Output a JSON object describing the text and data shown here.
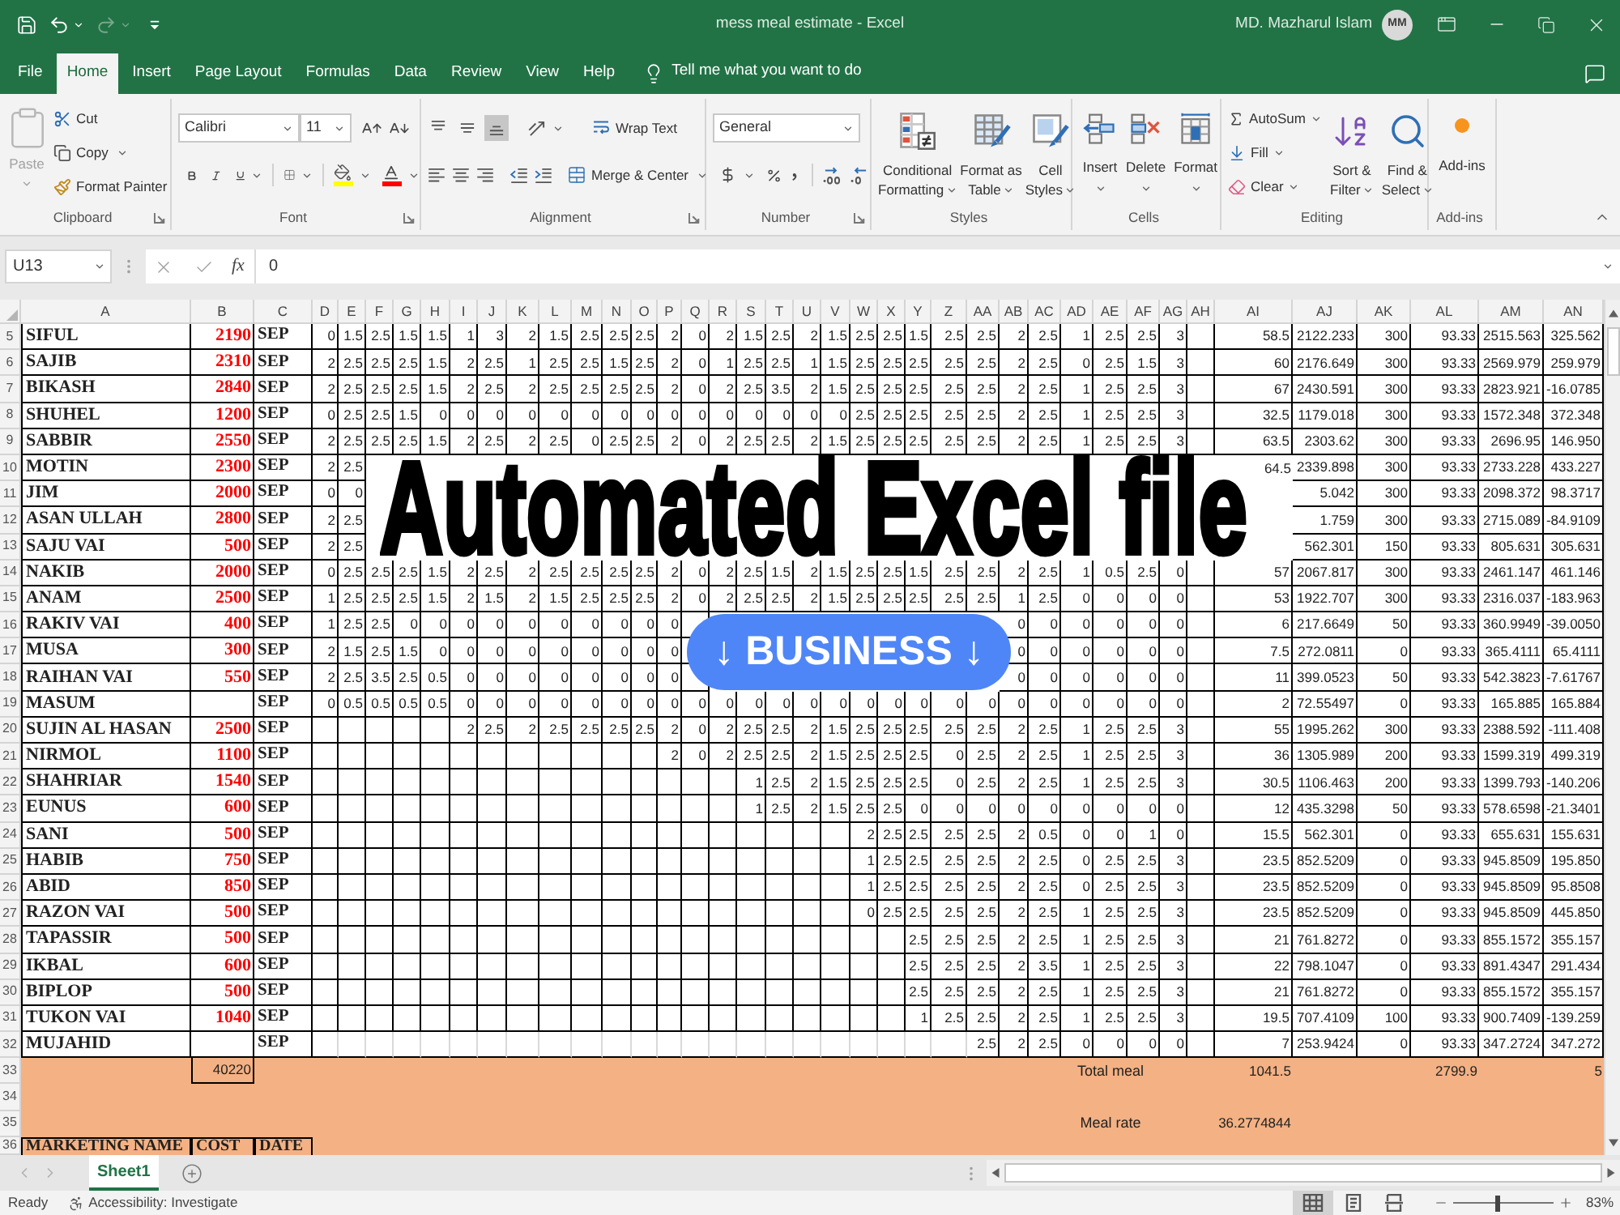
{
  "title_bar": {
    "title": "mess meal estimate - Excel",
    "user": "MD. Mazharul Islam",
    "avatar": "MM",
    "quick_access": [
      {
        "kind": "save",
        "disabled": false
      },
      {
        "kind": "undo",
        "disabled": false
      },
      {
        "kind": "redo",
        "disabled": true
      },
      {
        "kind": "customize",
        "disabled": false
      }
    ]
  },
  "menu_tabs": [
    {
      "label": "File",
      "selected": false
    },
    {
      "label": "Home",
      "selected": true
    },
    {
      "label": "Insert",
      "selected": false
    },
    {
      "label": "Page Layout",
      "selected": false
    },
    {
      "label": "Formulas",
      "selected": false
    },
    {
      "label": "Data",
      "selected": false
    },
    {
      "label": "Review",
      "selected": false
    },
    {
      "label": "View",
      "selected": false
    },
    {
      "label": "Help",
      "selected": false
    }
  ],
  "tell_me": "Tell me what you want to do",
  "ribbon": {
    "clipboard": {
      "label": "Clipboard",
      "paste": {
        "label": "Paste",
        "disabled": true
      },
      "cut": "Cut",
      "copy": "Copy",
      "format_painter": "Format Painter"
    },
    "font": {
      "label": "Font",
      "name": "Calibri",
      "size": "11"
    },
    "alignment": {
      "label": "Alignment",
      "vertical": [
        {
          "kind": "top",
          "selected": false
        },
        {
          "kind": "middle",
          "selected": false
        },
        {
          "kind": "bottom",
          "selected": true
        }
      ],
      "wrap_text": "Wrap Text",
      "merge": "Merge & Center"
    },
    "number": {
      "label": "Number",
      "format": "General"
    },
    "styles": {
      "label": "Styles",
      "buttons": [
        {
          "kind": "conditional",
          "lines": [
            "Conditional",
            "Formatting"
          ]
        },
        {
          "kind": "table",
          "lines": [
            "Format as",
            "Table"
          ]
        },
        {
          "kind": "cell",
          "lines": [
            "Cell",
            "Styles"
          ]
        }
      ]
    },
    "cells": {
      "label": "Cells",
      "buttons": [
        {
          "kind": "insert",
          "label": "Insert"
        },
        {
          "kind": "delete",
          "label": "Delete"
        },
        {
          "kind": "format",
          "label": "Format"
        }
      ]
    },
    "editing": {
      "label": "Editing",
      "autosum": "AutoSum",
      "fill": "Fill",
      "clear": "Clear",
      "sort": [
        "Sort &",
        "Filter"
      ],
      "find": [
        "Find &",
        "Select"
      ]
    },
    "addins": {
      "label": "Add-ins",
      "button": "Add-ins"
    }
  },
  "formula_bar": {
    "name_box": "U13",
    "function_icon": "fx",
    "formula": "0"
  },
  "sheet": {
    "columns": [
      "A",
      "B",
      "C",
      "D",
      "E",
      "F",
      "G",
      "H",
      "I",
      "J",
      "K",
      "L",
      "M",
      "N",
      "O",
      "P",
      "Q",
      "R",
      "S",
      "T",
      "U",
      "V",
      "W",
      "X",
      "Y",
      "Z",
      "AA",
      "AB",
      "AC",
      "AD",
      "AE",
      "AF",
      "AG",
      "AH",
      "AI",
      "AJ",
      "AK",
      "AL",
      "AM",
      "AN"
    ],
    "rows": [
      {
        "number": "5",
        "kind": "member",
        "cells": [
          "SIFUL",
          "2190",
          "SEP",
          "0",
          "1.5",
          "2.5",
          "1.5",
          "1.5",
          "1",
          "3",
          "2",
          "1.5",
          "2.5",
          "2.5",
          "2.5",
          "2",
          "0",
          "2",
          "1.5",
          "2.5",
          "2",
          "1.5",
          "2.5",
          "2.5",
          "1.5",
          "2.5",
          "2.5",
          "2",
          "2.5",
          "1",
          "2.5",
          "2.5",
          "3",
          null,
          "58.5",
          "2122.233",
          "300",
          "93.33",
          "2515.563",
          "325.562"
        ]
      },
      {
        "number": "6",
        "kind": "member",
        "cells": [
          "SAJIB",
          "2310",
          "SEP",
          "2",
          "2.5",
          "2.5",
          "2.5",
          "1.5",
          "2",
          "2.5",
          "1",
          "2.5",
          "2.5",
          "1.5",
          "2.5",
          "2",
          "0",
          "1",
          "2.5",
          "2.5",
          "1",
          "1.5",
          "2.5",
          "2.5",
          "2.5",
          "2.5",
          "2.5",
          "2",
          "2.5",
          "0",
          "2.5",
          "1.5",
          "3",
          null,
          "60",
          "2176.649",
          "300",
          "93.33",
          "2569.979",
          "259.979"
        ]
      },
      {
        "number": "7",
        "kind": "member",
        "cells": [
          "BIKASH",
          "2840",
          "SEP",
          "2",
          "2.5",
          "2.5",
          "2.5",
          "1.5",
          "2",
          "2.5",
          "2",
          "2.5",
          "2.5",
          "2.5",
          "2.5",
          "2",
          "0",
          "2",
          "2.5",
          "3.5",
          "2",
          "1.5",
          "2.5",
          "2.5",
          "2.5",
          "2.5",
          "2.5",
          "2",
          "2.5",
          "1",
          "2.5",
          "2.5",
          "3",
          null,
          "67",
          "2430.591",
          "300",
          "93.33",
          "2823.921",
          "-16.0785"
        ]
      },
      {
        "number": "8",
        "kind": "member",
        "cells": [
          "SHUHEL",
          "1200",
          "SEP",
          "0",
          "2.5",
          "2.5",
          "1.5",
          "0",
          "0",
          "0",
          "0",
          "0",
          "0",
          "0",
          "0",
          "0",
          "0",
          "0",
          "0",
          "0",
          "0",
          "0",
          "2.5",
          "2.5",
          "2.5",
          "2.5",
          "2.5",
          "2",
          "2.5",
          "1",
          "2.5",
          "2.5",
          "3",
          null,
          "32.5",
          "1179.018",
          "300",
          "93.33",
          "1572.348",
          "372.348"
        ]
      },
      {
        "number": "9",
        "kind": "member",
        "cells": [
          "SABBIR",
          "2550",
          "SEP",
          "2",
          "2.5",
          "2.5",
          "2.5",
          "1.5",
          "2",
          "2.5",
          "2",
          "2.5",
          "0",
          "2.5",
          "2.5",
          "2",
          "0",
          "2",
          "2.5",
          "2.5",
          "2",
          "1.5",
          "2.5",
          "2.5",
          "2.5",
          "2.5",
          "2.5",
          "2",
          "2.5",
          "1",
          "2.5",
          "2.5",
          "3",
          null,
          "63.5",
          "2303.62",
          "300",
          "93.33",
          "2696.95",
          "146.950"
        ]
      },
      {
        "number": "10",
        "kind": "member",
        "cells": [
          "MOTIN",
          "2300",
          "SEP",
          "2",
          "2.5",
          null,
          null,
          null,
          null,
          null,
          null,
          null,
          null,
          null,
          null,
          null,
          null,
          null,
          null,
          null,
          null,
          null,
          null,
          null,
          null,
          null,
          null,
          null,
          null,
          null,
          null,
          null,
          null,
          null,
          "64.5",
          "2339.898",
          "300",
          "93.33",
          "2733.228",
          "433.227"
        ]
      },
      {
        "number": "11",
        "kind": "member",
        "cells": [
          "JIM",
          "2000",
          "SEP",
          "0",
          "0",
          null,
          null,
          null,
          null,
          null,
          null,
          null,
          null,
          null,
          null,
          null,
          null,
          null,
          null,
          null,
          null,
          null,
          null,
          null,
          null,
          null,
          null,
          null,
          null,
          null,
          null,
          null,
          null,
          null,
          null,
          "5.042",
          "300",
          "93.33",
          "2098.372",
          "98.3717"
        ]
      },
      {
        "number": "12",
        "kind": "member",
        "cells": [
          "ASAN ULLAH",
          "2800",
          "SEP",
          "2",
          "2.5",
          null,
          null,
          null,
          null,
          null,
          null,
          null,
          null,
          null,
          null,
          null,
          null,
          null,
          null,
          null,
          null,
          null,
          null,
          null,
          null,
          null,
          null,
          null,
          null,
          null,
          null,
          null,
          null,
          null,
          null,
          "1.759",
          "300",
          "93.33",
          "2715.089",
          "-84.9109"
        ]
      },
      {
        "number": "13",
        "kind": "member",
        "cells": [
          "SAJU VAI",
          "500",
          "SEP",
          "2",
          "2.5",
          null,
          null,
          null,
          null,
          null,
          null,
          null,
          null,
          null,
          null,
          null,
          null,
          null,
          null,
          null,
          null,
          null,
          null,
          null,
          null,
          null,
          null,
          null,
          null,
          null,
          null,
          null,
          null,
          null,
          null,
          "562.301",
          "150",
          "93.33",
          "805.631",
          "305.631"
        ]
      },
      {
        "number": "14",
        "kind": "member",
        "cells": [
          "NAKIB",
          "2000",
          "SEP",
          "0",
          "2.5",
          "2.5",
          "2.5",
          "1.5",
          "2",
          "2.5",
          "2",
          "2.5",
          "2.5",
          "2.5",
          "2.5",
          "2",
          "0",
          "2",
          "2.5",
          "1.5",
          "2",
          "1.5",
          "2.5",
          "2.5",
          "1.5",
          "2.5",
          "2.5",
          "2",
          "2.5",
          "1",
          "0.5",
          "2.5",
          "0",
          null,
          "57",
          "2067.817",
          "300",
          "93.33",
          "2461.147",
          "461.146"
        ]
      },
      {
        "number": "15",
        "kind": "member",
        "cells": [
          "ANAM",
          "2500",
          "SEP",
          "1",
          "2.5",
          "2.5",
          "2.5",
          "1.5",
          "2",
          "1.5",
          "2",
          "1.5",
          "2.5",
          "2.5",
          "2.5",
          "2",
          "0",
          "2",
          "2.5",
          "2.5",
          "2",
          "1.5",
          "2.5",
          "2.5",
          "2.5",
          "2.5",
          "2.5",
          "1",
          "2.5",
          "0",
          "0",
          "0",
          "0",
          null,
          "53",
          "1922.707",
          "300",
          "93.33",
          "2316.037",
          "-183.963"
        ]
      },
      {
        "number": "16",
        "kind": "member",
        "cells": [
          "RAKIV VAI",
          "400",
          "SEP",
          "1",
          "2.5",
          "2.5",
          "0",
          "0",
          "0",
          "0",
          "0",
          "0",
          "0",
          "0",
          "0",
          "0",
          null,
          null,
          null,
          null,
          null,
          null,
          null,
          null,
          null,
          null,
          null,
          "0",
          "0",
          "0",
          "0",
          "0",
          "0",
          null,
          "6",
          "217.6649",
          "50",
          "93.33",
          "360.9949",
          "-39.0050"
        ]
      },
      {
        "number": "17",
        "kind": "member",
        "cells": [
          "MUSA",
          "300",
          "SEP",
          "2",
          "1.5",
          "2.5",
          "1.5",
          "0",
          "0",
          "0",
          "0",
          "0",
          "0",
          "0",
          "0",
          "0",
          null,
          null,
          null,
          null,
          null,
          null,
          null,
          null,
          null,
          null,
          null,
          "0",
          "0",
          "0",
          "0",
          "0",
          "0",
          null,
          "7.5",
          "272.0811",
          "0",
          "93.33",
          "365.4111",
          "65.4111"
        ]
      },
      {
        "number": "18",
        "kind": "member",
        "cells": [
          "RAIHAN VAI",
          "550",
          "SEP",
          "2",
          "2.5",
          "3.5",
          "2.5",
          "0.5",
          "0",
          "0",
          "0",
          "0",
          "0",
          "0",
          "0",
          "0",
          null,
          null,
          null,
          null,
          null,
          null,
          null,
          null,
          null,
          null,
          null,
          "0",
          "0",
          "0",
          "0",
          "0",
          "0",
          null,
          "11",
          "399.0523",
          "50",
          "93.33",
          "542.3823",
          "-7.61767"
        ]
      },
      {
        "number": "19",
        "kind": "member",
        "cells": [
          "MASUM",
          null,
          "SEP",
          "0",
          "0.5",
          "0.5",
          "0.5",
          "0.5",
          "0",
          "0",
          "0",
          "0",
          "0",
          "0",
          "0",
          "0",
          "0",
          "0",
          "0",
          "0",
          "0",
          "0",
          "0",
          "0",
          "0",
          "0",
          "0",
          "0",
          "0",
          "0",
          "0",
          "0",
          "0",
          null,
          "2",
          "72.55497",
          "0",
          "93.33",
          "165.885",
          "165.884"
        ]
      },
      {
        "number": "20",
        "kind": "member",
        "cells": [
          "SUJIN AL HASAN",
          "2500",
          "SEP",
          null,
          null,
          null,
          null,
          null,
          "2",
          "2.5",
          "2",
          "2.5",
          "2.5",
          "2.5",
          "2.5",
          "2",
          "0",
          "2",
          "2.5",
          "2.5",
          "2",
          "1.5",
          "2.5",
          "2.5",
          "2.5",
          "2.5",
          "2.5",
          "2",
          "2.5",
          "1",
          "2.5",
          "2.5",
          "3",
          null,
          "55",
          "1995.262",
          "300",
          "93.33",
          "2388.592",
          "-111.408"
        ]
      },
      {
        "number": "21",
        "kind": "member",
        "cells": [
          "NIRMOL",
          "1100",
          "SEP",
          null,
          null,
          null,
          null,
          null,
          null,
          null,
          null,
          null,
          null,
          null,
          null,
          "2",
          "0",
          "2",
          "2.5",
          "2.5",
          "2",
          "1.5",
          "2.5",
          "2.5",
          "2.5",
          "0",
          "2.5",
          "2",
          "2.5",
          "1",
          "2.5",
          "2.5",
          "3",
          null,
          "36",
          "1305.989",
          "200",
          "93.33",
          "1599.319",
          "499.319"
        ]
      },
      {
        "number": "22",
        "kind": "member",
        "cells": [
          "SHAHRIAR",
          "1540",
          "SEP",
          null,
          null,
          null,
          null,
          null,
          null,
          null,
          null,
          null,
          null,
          null,
          null,
          null,
          null,
          null,
          "1",
          "2.5",
          "2",
          "1.5",
          "2.5",
          "2.5",
          "2.5",
          "0",
          "2.5",
          "2",
          "2.5",
          "1",
          "2.5",
          "2.5",
          "3",
          null,
          "30.5",
          "1106.463",
          "200",
          "93.33",
          "1399.793",
          "-140.206"
        ]
      },
      {
        "number": "23",
        "kind": "member",
        "cells": [
          "EUNUS",
          "600",
          "SEP",
          null,
          null,
          null,
          null,
          null,
          null,
          null,
          null,
          null,
          null,
          null,
          null,
          null,
          null,
          null,
          "1",
          "2.5",
          "2",
          "1.5",
          "2.5",
          "2.5",
          "0",
          "0",
          "0",
          "0",
          "0",
          "0",
          "0",
          "0",
          "0",
          null,
          "12",
          "435.3298",
          "50",
          "93.33",
          "578.6598",
          "-21.3401"
        ]
      },
      {
        "number": "24",
        "kind": "member",
        "cells": [
          "SANI",
          "500",
          "SEP",
          null,
          null,
          null,
          null,
          null,
          null,
          null,
          null,
          null,
          null,
          null,
          null,
          null,
          null,
          null,
          null,
          null,
          null,
          null,
          "2",
          "2.5",
          "2.5",
          "2.5",
          "2.5",
          "2",
          "0.5",
          "0",
          "0",
          "1",
          "0",
          null,
          "15.5",
          "562.301",
          "0",
          "93.33",
          "655.631",
          "155.631"
        ]
      },
      {
        "number": "25",
        "kind": "member",
        "cells": [
          "HABIB",
          "750",
          "SEP",
          null,
          null,
          null,
          null,
          null,
          null,
          null,
          null,
          null,
          null,
          null,
          null,
          null,
          null,
          null,
          null,
          null,
          null,
          null,
          "1",
          "2.5",
          "2.5",
          "2.5",
          "2.5",
          "2",
          "2.5",
          "0",
          "2.5",
          "2.5",
          "3",
          null,
          "23.5",
          "852.5209",
          "0",
          "93.33",
          "945.8509",
          "195.850"
        ]
      },
      {
        "number": "26",
        "kind": "member",
        "cells": [
          "ABID",
          "850",
          "SEP",
          null,
          null,
          null,
          null,
          null,
          null,
          null,
          null,
          null,
          null,
          null,
          null,
          null,
          null,
          null,
          null,
          null,
          null,
          null,
          "1",
          "2.5",
          "2.5",
          "2.5",
          "2.5",
          "2",
          "2.5",
          "0",
          "2.5",
          "2.5",
          "3",
          null,
          "23.5",
          "852.5209",
          "0",
          "93.33",
          "945.8509",
          "95.8508"
        ]
      },
      {
        "number": "27",
        "kind": "member",
        "cells": [
          "RAZON VAI",
          "500",
          "SEP",
          null,
          null,
          null,
          null,
          null,
          null,
          null,
          null,
          null,
          null,
          null,
          null,
          null,
          null,
          null,
          null,
          null,
          null,
          null,
          "0",
          "2.5",
          "2.5",
          "2.5",
          "2.5",
          "2",
          "2.5",
          "1",
          "2.5",
          "2.5",
          "3",
          null,
          "23.5",
          "852.5209",
          "0",
          "93.33",
          "945.8509",
          "445.850"
        ]
      },
      {
        "number": "28",
        "kind": "member",
        "cells": [
          "TAPASSIR",
          "500",
          "SEP",
          null,
          null,
          null,
          null,
          null,
          null,
          null,
          null,
          null,
          null,
          null,
          null,
          null,
          null,
          null,
          null,
          null,
          null,
          null,
          null,
          null,
          "2.5",
          "2.5",
          "2.5",
          "2",
          "2.5",
          "1",
          "2.5",
          "2.5",
          "3",
          null,
          "21",
          "761.8272",
          "0",
          "93.33",
          "855.1572",
          "355.157"
        ]
      },
      {
        "number": "29",
        "kind": "member",
        "cells": [
          "IKBAL",
          "600",
          "SEP",
          null,
          null,
          null,
          null,
          null,
          null,
          null,
          null,
          null,
          null,
          null,
          null,
          null,
          null,
          null,
          null,
          null,
          null,
          null,
          null,
          null,
          "2.5",
          "2.5",
          "2.5",
          "2",
          "3.5",
          "1",
          "2.5",
          "2.5",
          "3",
          null,
          "22",
          "798.1047",
          "0",
          "93.33",
          "891.4347",
          "291.434"
        ]
      },
      {
        "number": "30",
        "kind": "member",
        "cells": [
          "BIPLOP",
          "500",
          "SEP",
          null,
          null,
          null,
          null,
          null,
          null,
          null,
          null,
          null,
          null,
          null,
          null,
          null,
          null,
          null,
          null,
          null,
          null,
          null,
          null,
          null,
          "2.5",
          "2.5",
          "2.5",
          "2",
          "2.5",
          "1",
          "2.5",
          "2.5",
          "3",
          null,
          "21",
          "761.8272",
          "0",
          "93.33",
          "855.1572",
          "355.157"
        ]
      },
      {
        "number": "31",
        "kind": "member",
        "cells": [
          "TUKON VAI",
          "1040",
          "SEP",
          null,
          null,
          null,
          null,
          null,
          null,
          null,
          null,
          null,
          null,
          null,
          null,
          null,
          null,
          null,
          null,
          null,
          null,
          null,
          null,
          null,
          "1",
          "2.5",
          "2.5",
          "2",
          "2.5",
          "1",
          "2.5",
          "2.5",
          "3",
          null,
          "19.5",
          "707.4109",
          "100",
          "93.33",
          "900.7409",
          "-139.259"
        ]
      },
      {
        "number": "32",
        "kind": "member",
        "cells": [
          "MUJAHID",
          null,
          "SEP",
          null,
          null,
          null,
          null,
          null,
          null,
          null,
          null,
          null,
          null,
          null,
          null,
          null,
          null,
          null,
          null,
          null,
          null,
          null,
          null,
          null,
          null,
          null,
          "2.5",
          "2",
          "2.5",
          "0",
          "0",
          "0",
          "0",
          null,
          "7",
          "253.9424",
          "0",
          "93.33",
          "347.2724",
          "347.272"
        ]
      },
      {
        "number": "33",
        "kind": "summary",
        "cells": [
          null,
          "40220",
          null,
          null,
          null,
          null,
          null,
          null,
          null,
          null,
          null,
          null,
          null,
          null,
          null,
          null,
          null,
          null,
          null,
          null,
          null,
          null,
          null,
          null,
          null,
          null,
          null,
          null,
          null,
          null,
          "Total meal",
          null,
          null,
          null,
          "1041.5",
          null,
          null,
          "2799.9",
          null,
          "5"
        ]
      },
      {
        "number": "34",
        "kind": "summary"
      },
      {
        "number": "35",
        "kind": "summary",
        "cells": [
          null,
          null,
          null,
          null,
          null,
          null,
          null,
          null,
          null,
          null,
          null,
          null,
          null,
          null,
          null,
          null,
          null,
          null,
          null,
          null,
          null,
          null,
          null,
          null,
          null,
          null,
          null,
          null,
          null,
          null,
          "Meal rate",
          null,
          null,
          null,
          "36.2774844"
        ]
      },
      {
        "number": "36",
        "kind": "header",
        "cells": [
          "MARKETING NAME",
          "COST",
          "DATE"
        ]
      }
    ]
  },
  "sheet_tabs": [
    {
      "label": "Sheet1",
      "selected": true
    }
  ],
  "status_bar": {
    "status": "Ready",
    "accessibility": "Accessibility: Investigate",
    "views": [
      {
        "kind": "normal",
        "selected": true
      },
      {
        "kind": "page_layout",
        "selected": false
      },
      {
        "kind": "page_break",
        "selected": false
      }
    ],
    "zoom": {
      "level": 0.45,
      "reading": "83%"
    }
  },
  "overlay": {
    "headline": "Automated Excel file",
    "badge": "↓ BUSINESS ↓"
  }
}
